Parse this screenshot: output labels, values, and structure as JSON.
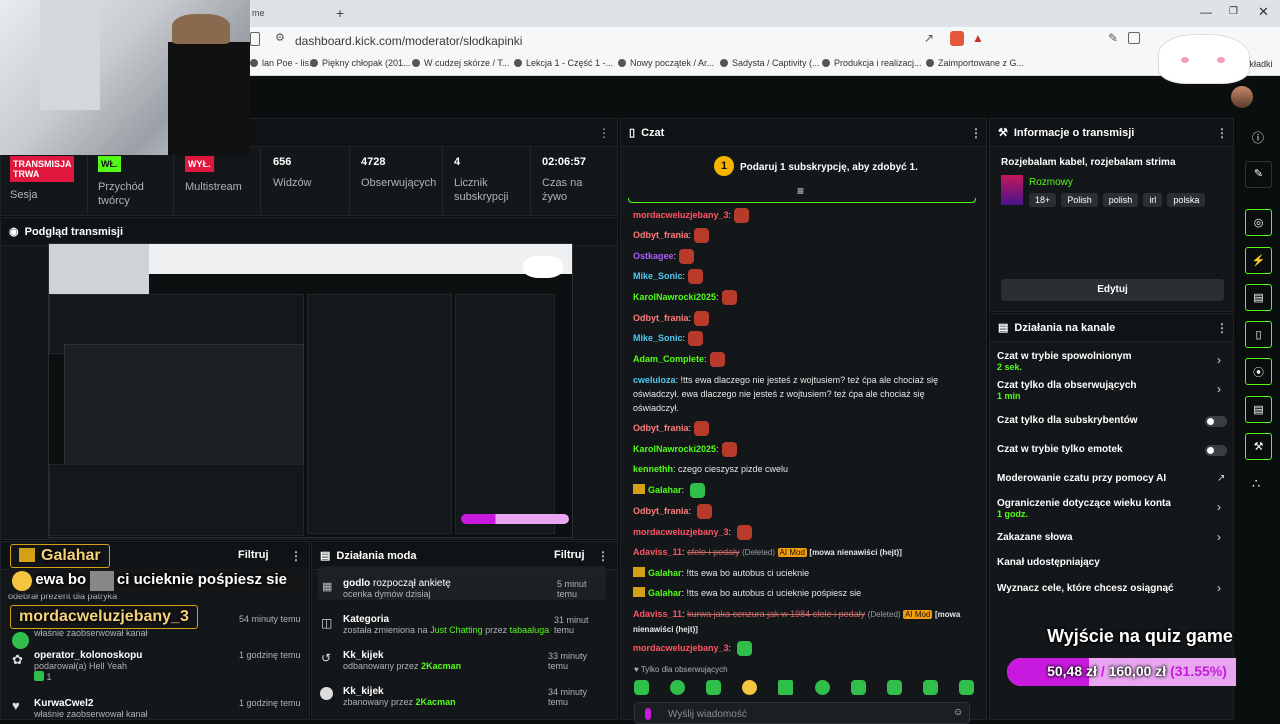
{
  "browser": {
    "tab_title": "me",
    "new_tab": "+",
    "url": "dashboard.kick.com/moderator/slodkapinki",
    "bookmarks": [
      "lan Poe - lis...",
      "Piękny chłopak (201...",
      "W cudzej skórze / T...",
      "Lekcja 1 - Część 1 -...",
      "Nowy początek / Ar...",
      "Sadysta / Captivity (...",
      "Produkcja i realizacj...",
      "Zaimportowane z G...",
      "zakładki"
    ]
  },
  "stats": [
    {
      "value": "TRANSMISJA TRWA",
      "label": "Sesja"
    },
    {
      "value": "WŁ.",
      "label": "Przychód twórcy"
    },
    {
      "value": "WYŁ.",
      "label": "Multistream"
    },
    {
      "value": "656",
      "label": "Widzów"
    },
    {
      "value": "4728",
      "label": "Obserwujących"
    },
    {
      "value": "4",
      "label": "Licznik subskrypcji"
    },
    {
      "value": "02:06:57",
      "label": "Czas na żywo"
    }
  ],
  "preview": {
    "title": "Podgląd transmisji"
  },
  "chat": {
    "title": "Czat",
    "goal_number": "1",
    "goal_text": "Podaruj 1 subskrypcję, aby zdobyć 1.",
    "messages": [
      {
        "user": "mordacweluzjebany_3",
        "color": "#ff5566",
        "text": ":"
      },
      {
        "user": "Odbyt_frania",
        "color": "#ff7a7a",
        "text": ":"
      },
      {
        "user": "Ostkagee",
        "color": "#b05cff",
        "text": ":"
      },
      {
        "user": "Mike_Sonic",
        "color": "#4cc9f0",
        "text": ":"
      },
      {
        "user": "KarolNawrocki2025",
        "color": "#53fc18",
        "text": ":"
      },
      {
        "user": "Odbyt_frania",
        "color": "#ff7a7a",
        "text": ":"
      },
      {
        "user": "Mike_Sonic",
        "color": "#4cc9f0",
        "text": ":"
      },
      {
        "user": "Adam_Complete",
        "color": "#53fc18",
        "text": ":"
      }
    ],
    "long_msg_user": "cweluloza",
    "long_msg_text": ": !tts ewa dlaczego nie jesteś z wojtusiem? też ćpa ale chociaż się oświadczył. ewa dlaczego nie jesteś z wojtusiem? też ćpa ale chociaż się oświadczył.",
    "messages2": [
      {
        "user": "Odbyt_frania",
        "color": "#ff7a7a",
        "text": ":"
      },
      {
        "user": "KarolNawrocki2025",
        "color": "#53fc18",
        "text": ":"
      }
    ],
    "kenneth_user": "kennethh",
    "kenneth_text": ": czego cieszysz pizde cwelu",
    "galahar_user": "Galahar",
    "odbyt_user": "Odbyt_frania",
    "morda_user": "mordacweluzjebany_3",
    "adaviss_user": "Adaviss_11",
    "adaviss_text1": "cfele i pedaly",
    "deleted_label": "(Deleted)",
    "ai_mod_label": "AI Mod",
    "hate_label": "[mowa nienawiści (hejt)]",
    "galahar_text1": ": !tts ewa bo autobus ci ucieknie",
    "galahar_text2": ": !tts ewa bo autobus ci ucieknie pośpiesz sie",
    "adaviss_text2": "kurwa jaka cenzura jak w 1984 cfele i pedaly",
    "hate_label2_a": "[mowa",
    "hate_label2_b": "nienawiści (hejt)]",
    "followers_only": "Tylko dla obserwujących",
    "input_placeholder": "Wyślij wiadomość"
  },
  "info": {
    "title": "Informacje o transmisji",
    "stream_title": "Rozjebalam kabel, rozjebalam strima",
    "category": "Rozmowy",
    "tags": [
      "18+",
      "Polish",
      "polish",
      "irl",
      "polska"
    ],
    "edit_button": "Edytuj"
  },
  "channel_actions": {
    "title": "Działania na kanale",
    "items": [
      {
        "label": "Czat w trybie spowolnionym",
        "sub": "2 sek."
      },
      {
        "label": "Czat tylko dla obserwujących",
        "sub": "1 min"
      },
      {
        "label": "Czat tylko dla subskrybentów",
        "sub": ""
      },
      {
        "label": "Czat w trybie tylko emotek",
        "sub": ""
      },
      {
        "label": "Moderowanie czatu przy pomocy AI",
        "sub": ""
      },
      {
        "label": "Ograniczenie dotyczące wieku konta",
        "sub": "1 godz."
      },
      {
        "label": "Zakazane słowa",
        "sub": ""
      },
      {
        "label": "Kanał udostępniający",
        "sub": ""
      },
      {
        "label": "Wyznacz cele, które chcesz osiągnąć",
        "sub": ""
      }
    ]
  },
  "quiz": {
    "title": "Wyjście na quiz game",
    "current": "50,48 zł",
    "separator": "/",
    "target": "160,00 zł",
    "percent": "(31.55%)",
    "progress": 0.3155
  },
  "activity_panel": {
    "filter_label": "Filtruj",
    "overlay_user1": "Galahar",
    "overlay_line2a": "ewa bo",
    "overlay_line2b": "ci ucieknie pośpiesz sie",
    "overlay_user2": "mordacweluzjebany_3",
    "items": [
      {
        "title": "",
        "sub": "odebrał prezent dla patryka",
        "time": ""
      },
      {
        "title": "",
        "sub": "właśnie zaobserwował kanał",
        "time": "54 minuty temu"
      },
      {
        "title": "operator_kolonoskopu",
        "sub": "podarował(a) Hell Yeah",
        "count": "1",
        "time": "1 godzinę temu"
      },
      {
        "title": "KurwaCwel2",
        "sub": "właśnie zaobserwował kanał",
        "time": "1 godzinę temu"
      }
    ]
  },
  "mod_actions": {
    "title": "Działania moda",
    "filter_label": "Filtruj",
    "items": [
      {
        "title": "godlo",
        "title_rest": " rozpoczął ankietę",
        "sub": "ocenka dymów dzisiaj",
        "time": "5 minut temu"
      },
      {
        "title": "Kategoria",
        "sub": "została zmieniona na ",
        "sub_green1": "Just Chatting",
        "sub_mid": " przez ",
        "sub_green2": "tabaaluga",
        "time": "31 minut temu"
      },
      {
        "title": "Kk_kijek",
        "sub": "odbanowany przez ",
        "sub_green": "2Kacman",
        "time": "33 minuty temu"
      },
      {
        "title": "Kk_kijek",
        "sub": "zbanowany przez ",
        "sub_green": "2Kacman",
        "time": "34 minuty temu"
      }
    ]
  }
}
